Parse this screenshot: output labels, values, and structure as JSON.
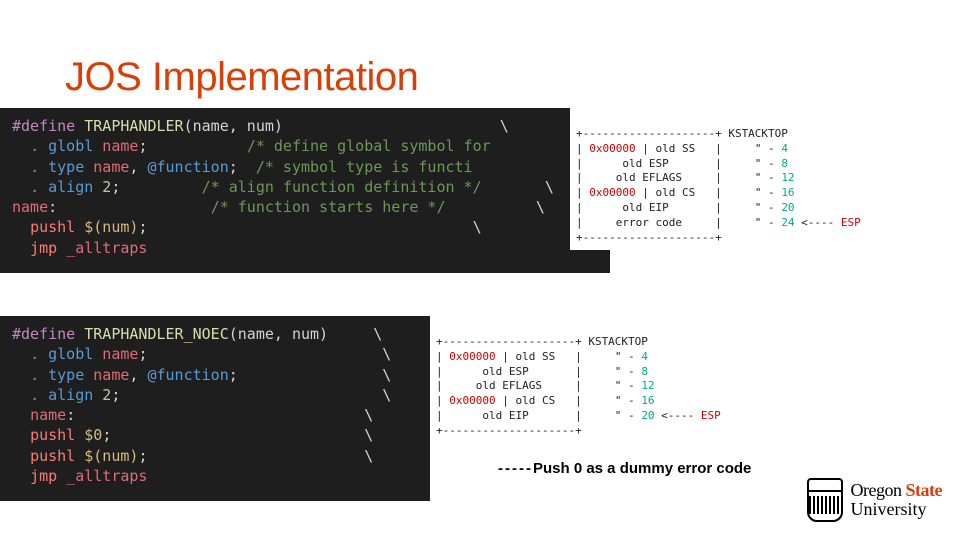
{
  "title": "JOS Implementation",
  "code1": {
    "l0a": "#define",
    "l0b": " TRAPHANDLER",
    "l0c": "(name, num)",
    "l1a": ". globl",
    "l1b": " name",
    "l1c": ";           ",
    "l1d": "/* define global symbol for",
    "l2a": ". type",
    "l2b": " name",
    "l2c": ", ",
    "l2d": "@function",
    "l2e": ";  ",
    "l2f": "/* symbol type is functi",
    "l3a": ". align",
    "l3b": " 2",
    "l3c": ";         ",
    "l3d": "/* align function definition */",
    "l4a": "name",
    "l4b": ":                 ",
    "l4c": "/* function starts here */",
    "l5a": "pushl",
    "l5b": " $(num)",
    "l5c": ";",
    "l6a": "jmp",
    "l6b": " _alltraps",
    "bs": "\\"
  },
  "code2": {
    "l0a": "#define",
    "l0b": " TRAPHANDLER_NOEC",
    "l0c": "(name, num)",
    "l1a": ". globl",
    "l1b": " name",
    "l1c": ";",
    "l2a": ". type",
    "l2b": " name",
    "l2c": ", ",
    "l2d": "@function",
    "l2e": ";",
    "l3a": ". align",
    "l3b": " 2",
    "l3c": ";",
    "l4a": "name",
    "l4b": ":",
    "l5a": "pushl",
    "l5b": " $0",
    "l5c": ";",
    "l6a": "pushl",
    "l6b": " $(num)",
    "l6c": ";",
    "l7a": "jmp",
    "l7b": " _alltraps",
    "bs": "\\"
  },
  "stack1": {
    "row0": "+--------------------+ KSTACKTOP",
    "row1a": "| ",
    "row1b": "0x00000",
    "row1c": " | old SS   |     \" - ",
    "row1d": "4",
    "row2a": "|      old ESP       |     \" - ",
    "row2d": "8",
    "row3a": "|     old EFLAGS     |     \" - ",
    "row3d": "12",
    "row4a": "| ",
    "row4b": "0x00000",
    "row4c": " | old CS   |     \" - ",
    "row4d": "16",
    "row5a": "|      old EIP       |     \" - ",
    "row5d": "20",
    "row6a": "|     error code     |     \" - ",
    "row6d": "24",
    "row6e": " <---- ",
    "row6f": "ESP",
    "row7": "+--------------------+"
  },
  "stack2": {
    "row0": "+--------------------+ KSTACKTOP",
    "row1a": "| ",
    "row1b": "0x00000",
    "row1c": " | old SS   |     \" - ",
    "row1d": "4",
    "row2a": "|      old ESP       |     \" - ",
    "row2d": "8",
    "row3a": "|     old EFLAGS     |     \" - ",
    "row3d": "12",
    "row4a": "| ",
    "row4b": "0x00000",
    "row4c": " | old CS   |     \" - ",
    "row4d": "16",
    "row5a": "|      old EIP       |     \" - ",
    "row5d": "20",
    "row5e": " <---- ",
    "row5f": "ESP",
    "row6": "+--------------------+"
  },
  "annot": {
    "dash": "-----",
    "text": "Push 0 as a dummy error code"
  },
  "logo": {
    "l1a": "Oregon ",
    "l1b": "State",
    "l2": "University"
  }
}
